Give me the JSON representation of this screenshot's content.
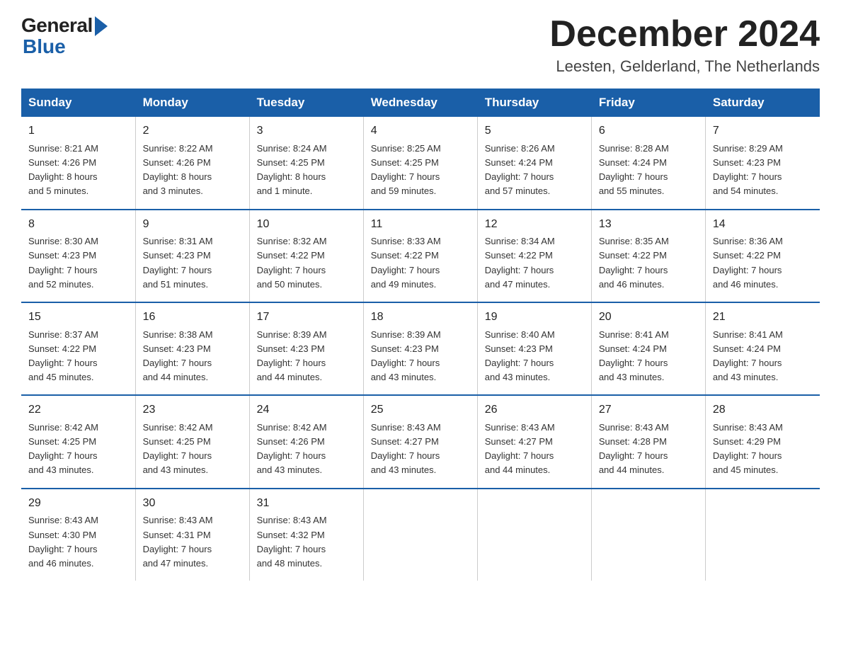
{
  "logo": {
    "general": "General",
    "blue": "Blue"
  },
  "title": {
    "month": "December 2024",
    "location": "Leesten, Gelderland, The Netherlands"
  },
  "weekdays": [
    "Sunday",
    "Monday",
    "Tuesday",
    "Wednesday",
    "Thursday",
    "Friday",
    "Saturday"
  ],
  "weeks": [
    [
      {
        "day": "1",
        "info": "Sunrise: 8:21 AM\nSunset: 4:26 PM\nDaylight: 8 hours\nand 5 minutes."
      },
      {
        "day": "2",
        "info": "Sunrise: 8:22 AM\nSunset: 4:26 PM\nDaylight: 8 hours\nand 3 minutes."
      },
      {
        "day": "3",
        "info": "Sunrise: 8:24 AM\nSunset: 4:25 PM\nDaylight: 8 hours\nand 1 minute."
      },
      {
        "day": "4",
        "info": "Sunrise: 8:25 AM\nSunset: 4:25 PM\nDaylight: 7 hours\nand 59 minutes."
      },
      {
        "day": "5",
        "info": "Sunrise: 8:26 AM\nSunset: 4:24 PM\nDaylight: 7 hours\nand 57 minutes."
      },
      {
        "day": "6",
        "info": "Sunrise: 8:28 AM\nSunset: 4:24 PM\nDaylight: 7 hours\nand 55 minutes."
      },
      {
        "day": "7",
        "info": "Sunrise: 8:29 AM\nSunset: 4:23 PM\nDaylight: 7 hours\nand 54 minutes."
      }
    ],
    [
      {
        "day": "8",
        "info": "Sunrise: 8:30 AM\nSunset: 4:23 PM\nDaylight: 7 hours\nand 52 minutes."
      },
      {
        "day": "9",
        "info": "Sunrise: 8:31 AM\nSunset: 4:23 PM\nDaylight: 7 hours\nand 51 minutes."
      },
      {
        "day": "10",
        "info": "Sunrise: 8:32 AM\nSunset: 4:22 PM\nDaylight: 7 hours\nand 50 minutes."
      },
      {
        "day": "11",
        "info": "Sunrise: 8:33 AM\nSunset: 4:22 PM\nDaylight: 7 hours\nand 49 minutes."
      },
      {
        "day": "12",
        "info": "Sunrise: 8:34 AM\nSunset: 4:22 PM\nDaylight: 7 hours\nand 47 minutes."
      },
      {
        "day": "13",
        "info": "Sunrise: 8:35 AM\nSunset: 4:22 PM\nDaylight: 7 hours\nand 46 minutes."
      },
      {
        "day": "14",
        "info": "Sunrise: 8:36 AM\nSunset: 4:22 PM\nDaylight: 7 hours\nand 46 minutes."
      }
    ],
    [
      {
        "day": "15",
        "info": "Sunrise: 8:37 AM\nSunset: 4:22 PM\nDaylight: 7 hours\nand 45 minutes."
      },
      {
        "day": "16",
        "info": "Sunrise: 8:38 AM\nSunset: 4:23 PM\nDaylight: 7 hours\nand 44 minutes."
      },
      {
        "day": "17",
        "info": "Sunrise: 8:39 AM\nSunset: 4:23 PM\nDaylight: 7 hours\nand 44 minutes."
      },
      {
        "day": "18",
        "info": "Sunrise: 8:39 AM\nSunset: 4:23 PM\nDaylight: 7 hours\nand 43 minutes."
      },
      {
        "day": "19",
        "info": "Sunrise: 8:40 AM\nSunset: 4:23 PM\nDaylight: 7 hours\nand 43 minutes."
      },
      {
        "day": "20",
        "info": "Sunrise: 8:41 AM\nSunset: 4:24 PM\nDaylight: 7 hours\nand 43 minutes."
      },
      {
        "day": "21",
        "info": "Sunrise: 8:41 AM\nSunset: 4:24 PM\nDaylight: 7 hours\nand 43 minutes."
      }
    ],
    [
      {
        "day": "22",
        "info": "Sunrise: 8:42 AM\nSunset: 4:25 PM\nDaylight: 7 hours\nand 43 minutes."
      },
      {
        "day": "23",
        "info": "Sunrise: 8:42 AM\nSunset: 4:25 PM\nDaylight: 7 hours\nand 43 minutes."
      },
      {
        "day": "24",
        "info": "Sunrise: 8:42 AM\nSunset: 4:26 PM\nDaylight: 7 hours\nand 43 minutes."
      },
      {
        "day": "25",
        "info": "Sunrise: 8:43 AM\nSunset: 4:27 PM\nDaylight: 7 hours\nand 43 minutes."
      },
      {
        "day": "26",
        "info": "Sunrise: 8:43 AM\nSunset: 4:27 PM\nDaylight: 7 hours\nand 44 minutes."
      },
      {
        "day": "27",
        "info": "Sunrise: 8:43 AM\nSunset: 4:28 PM\nDaylight: 7 hours\nand 44 minutes."
      },
      {
        "day": "28",
        "info": "Sunrise: 8:43 AM\nSunset: 4:29 PM\nDaylight: 7 hours\nand 45 minutes."
      }
    ],
    [
      {
        "day": "29",
        "info": "Sunrise: 8:43 AM\nSunset: 4:30 PM\nDaylight: 7 hours\nand 46 minutes."
      },
      {
        "day": "30",
        "info": "Sunrise: 8:43 AM\nSunset: 4:31 PM\nDaylight: 7 hours\nand 47 minutes."
      },
      {
        "day": "31",
        "info": "Sunrise: 8:43 AM\nSunset: 4:32 PM\nDaylight: 7 hours\nand 48 minutes."
      },
      {
        "day": "",
        "info": ""
      },
      {
        "day": "",
        "info": ""
      },
      {
        "day": "",
        "info": ""
      },
      {
        "day": "",
        "info": ""
      }
    ]
  ]
}
